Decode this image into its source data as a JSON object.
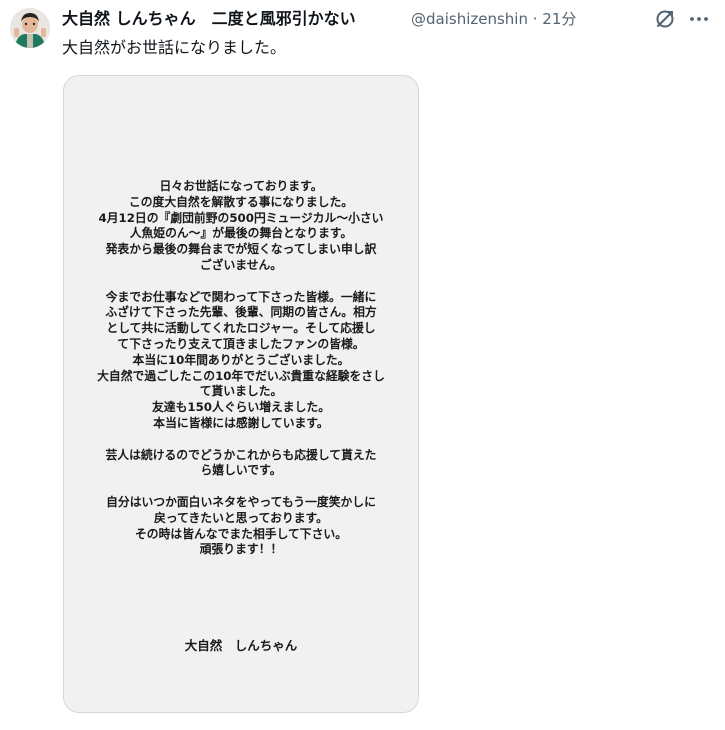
{
  "tweet": {
    "author_name": "大自然 しんちゃん　二度と風邪引かない",
    "handle_time": "@daishizenshin · 21分",
    "text": "大自然がお世話になりました。",
    "avatar_icon": "avatar-photo-icon",
    "grok_icon": "grok-icon",
    "more_icon": "more-dots-icon"
  },
  "image": {
    "paragraphs": [
      [
        "日々お世話になっております。",
        "この度大自然を解散する事になりました。",
        "4月12日の『劇団前野の500円ミュージカル～小さい",
        "人魚姫のん～』が最後の舞台となります。",
        "発表から最後の舞台までが短くなってしまい申し訳",
        "ございません。"
      ],
      [
        "今までお仕事などで関わって下さった皆様。一緒に",
        "ふざけて下さった先輩、後輩、同期の皆さん。相方",
        "として共に活動してくれたロジャー。そして応援し",
        "て下さったり支えて頂きましたファンの皆様。",
        "本当に10年間ありがとうございました。",
        "大自然で過ごしたこの10年でだいぶ貴重な経験をさし",
        "て貰いました。",
        "友達も150人ぐらい増えました。",
        "本当に皆様には感謝しています。"
      ],
      [
        "芸人は続けるのでどうかこれからも応援して貰えた",
        "ら嬉しいです。"
      ],
      [
        "自分はいつか面白いネタをやってもう一度笑かしに",
        "戻ってきたいと思っております。",
        "その時は皆んなでまた相手して下さい。",
        "頑張ります！！"
      ]
    ],
    "signature": "大自然　しんちゃん"
  }
}
